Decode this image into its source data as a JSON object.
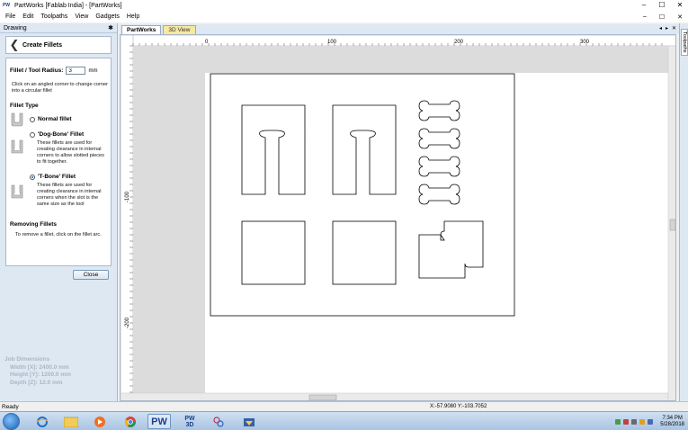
{
  "window": {
    "logo": "PW",
    "title": "PartWorks [Fablab India] - [PartWorks]",
    "minimize": "–",
    "maximize": "☐",
    "close": "✕"
  },
  "menu": {
    "items": [
      "File",
      "Edit",
      "Toolpaths",
      "View",
      "Gadgets",
      "Help"
    ],
    "ctrl_min": "–",
    "ctrl_max": "☐",
    "ctrl_close": "✕"
  },
  "panel": {
    "header": "Drawing",
    "pin": "✱",
    "back": "❮",
    "title": "Create Fillets",
    "radius_label": "Fillet / Tool Radius:",
    "radius_value": "3",
    "radius_unit": "mm",
    "hint": "Click on an angled corner to change corner into a circular fillet",
    "fillet_type_label": "Fillet Type",
    "normal_label": "Normal fillet",
    "dogbone_label": "'Dog-Bone' Fillet",
    "dogbone_desc": "These fillets are used for creating clearance in internal corners to allow slotted pieces to fit together.",
    "tbone_label": "'T-Bone' Fillet",
    "tbone_desc": "These fillets are used for creating clearance in internal corners when the slot is the same size as the tool",
    "selected": "tbone",
    "removing_label": "Removing Fillets",
    "removing_desc": "To remove a fillet, click on the fillet arc.",
    "close_label": "Close"
  },
  "job": {
    "title": "Job Dimensions",
    "width": "Width  [X]: 2400.0 mm",
    "height": "Height [Y]: 1200.0 mm",
    "depth": "Depth  [Z]: 12.0 mm"
  },
  "tabs": {
    "items": [
      {
        "label": "PartWorks",
        "active": true
      },
      {
        "label": "3D View",
        "active": false
      }
    ],
    "left_arrow": "◂",
    "right_arrow": "▸",
    "close": "✕"
  },
  "rulers": {
    "top": [
      "0",
      "100",
      "200",
      "300"
    ],
    "left": [
      "-100",
      "-200"
    ]
  },
  "right_panel": {
    "label": "Toolpaths"
  },
  "status": {
    "left": "Ready",
    "coords": "X:-57.9080 Y:-103.7052"
  },
  "taskbar": {
    "pw_label": "PW",
    "pw3d_top": "PW",
    "pw3d_bottom": "3D",
    "time": "7:34 PM",
    "date": "5/28/2018"
  }
}
